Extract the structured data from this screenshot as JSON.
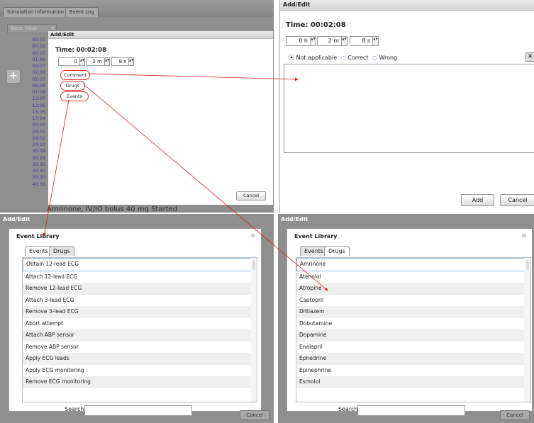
{
  "app": {
    "tabs": [
      "Simulation Information",
      "Event Log"
    ],
    "view": "Basic View",
    "times": [
      "00:01",
      "00:02",
      "00:10",
      "01:09",
      "02:07",
      "02:08",
      "05:07",
      "05:08",
      "07:08",
      "10:07",
      "12:06",
      "15:05",
      "17:04",
      "20:03",
      "24:01",
      "24:02",
      "24:10",
      "30:09",
      "30:29",
      "30:30",
      "30:30",
      "35:30",
      "40:30"
    ],
    "bottom_text": "Amrinone, IV/IO bolus 40 mg Started"
  },
  "small_dialog": {
    "title": "Add/Edit",
    "time_label": "Time: 00:02:08",
    "hours": "0",
    "minutes": "2 m",
    "seconds": "8 s",
    "buttons": [
      "Comment",
      "Drugs",
      "Events"
    ],
    "cancel": "Cancel"
  },
  "big_dialog": {
    "title": "Add/Edit",
    "time_label": "Time: 00:02:08",
    "hours": "0 h",
    "minutes": "2 m",
    "seconds": "8 s",
    "radios": [
      "Not applicable",
      "Correct",
      "Wrong"
    ],
    "add": "Add",
    "cancel": "Cancel"
  },
  "events_panel": {
    "title": "Add/Edit",
    "library_title": "Event Library",
    "tabs": [
      "Events",
      "Drugs"
    ],
    "items": [
      "Obtain 12-lead ECG",
      "Attach 12-lead ECG",
      "Remove 12-lead ECG",
      "Attach 3-lead ECG",
      "Remove 3-lead ECG",
      "Abort attempt",
      "Attach ABP sensor",
      "Remove ABP sensor",
      "Apply ECG leads",
      "Apply ECG monitoring",
      "Remove ECG monitoring"
    ],
    "search_label": "Search:",
    "cancel": "Cancel"
  },
  "drugs_panel": {
    "title": "Add/Edit",
    "library_title": "Event Library",
    "tabs": [
      "Events",
      "Drugs"
    ],
    "items": [
      "Amrinone",
      "Atenolol",
      "Atropine",
      "Captopril",
      "Diltiazem",
      "Dobutamine",
      "Dopamine",
      "Enalapril",
      "Ephedrine",
      "Epinephrine",
      "Esmolol"
    ],
    "search_label": "Search:",
    "cancel": "Cancel"
  },
  "colors": {
    "arrow": "#dd2222",
    "time_text": "#3b3b9b",
    "panel_bg": "#8f8f8f"
  }
}
